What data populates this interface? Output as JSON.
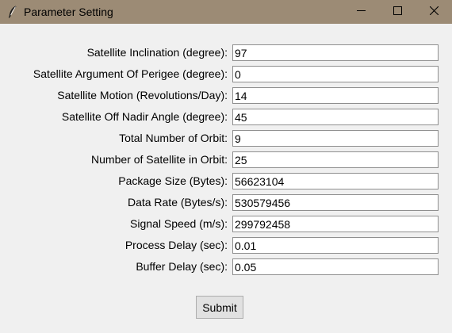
{
  "window": {
    "title": "Parameter Setting",
    "app_icon": "feather-icon",
    "controls": {
      "minimize_icon": "minimize-icon",
      "maximize_icon": "maximize-icon",
      "close_icon": "close-icon"
    },
    "titlebar_color": "#9c8b75"
  },
  "form": {
    "fields": [
      {
        "label": "Satellite Inclination (degree):",
        "value": "97"
      },
      {
        "label": "Satellite Argument Of Perigee (degree):",
        "value": "0"
      },
      {
        "label": "Satellite Motion (Revolutions/Day):",
        "value": "14"
      },
      {
        "label": "Satellite Off Nadir Angle (degree):",
        "value": "45"
      },
      {
        "label": "Total Number of Orbit:",
        "value": "9"
      },
      {
        "label": "Number of Satellite in Orbit:",
        "value": "25"
      },
      {
        "label": "Package Size (Bytes):",
        "value": "56623104"
      },
      {
        "label": "Data Rate (Bytes/s):",
        "value": "530579456"
      },
      {
        "label": "Signal Speed (m/s):",
        "value": "299792458"
      },
      {
        "label": "Process Delay (sec):",
        "value": "0.01"
      },
      {
        "label": "Buffer Delay (sec):",
        "value": "0.05"
      }
    ],
    "submit_label": "Submit"
  }
}
